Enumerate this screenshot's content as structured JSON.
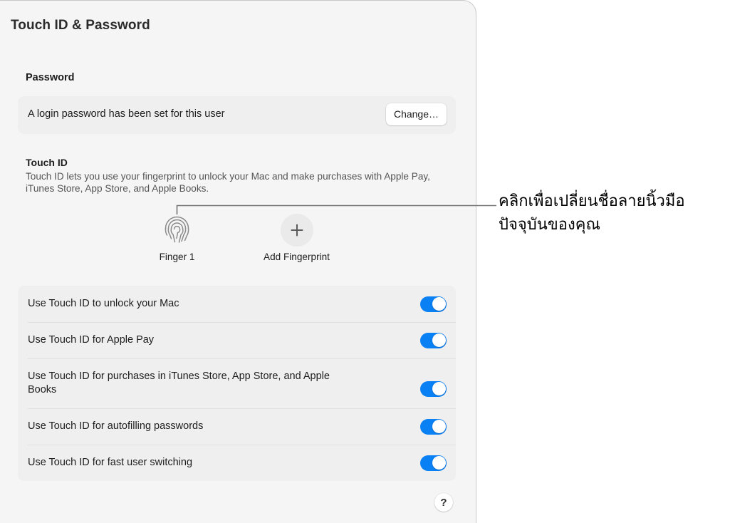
{
  "window": {
    "title": "Touch ID & Password"
  },
  "password_section": {
    "heading": "Password",
    "status_text": "A login password has been set for this user",
    "change_button_label": "Change…"
  },
  "touchid_section": {
    "heading": "Touch ID",
    "description": "Touch ID lets you use your fingerprint to unlock your Mac and make purchases with Apple Pay, iTunes Store, App Store, and Apple Books.",
    "fingerprints": [
      {
        "label": "Finger 1",
        "icon": "fingerprint-icon"
      }
    ],
    "add_fingerprint": {
      "label": "Add Fingerprint",
      "icon": "plus-icon"
    }
  },
  "options": [
    {
      "label": "Use Touch ID to unlock your Mac",
      "enabled": true
    },
    {
      "label": "Use Touch ID for Apple Pay",
      "enabled": true
    },
    {
      "label": "Use Touch ID for purchases in iTunes Store, App Store, and Apple Books",
      "enabled": true
    },
    {
      "label": "Use Touch ID for autofilling passwords",
      "enabled": true
    },
    {
      "label": "Use Touch ID for fast user switching",
      "enabled": true
    }
  ],
  "help_button": {
    "label": "?",
    "icon": "question-mark-icon"
  },
  "annotation": {
    "text": "คลิกเพื่อเปลี่ยนชื่อลายนิ้วมือปัจจุบันของคุณ",
    "line_color": "#757575"
  },
  "colors": {
    "accent_blue": "#0a80f5",
    "window_bg": "#f5f5f5",
    "card_bg": "#efefef",
    "page_bg": "#ffffff",
    "divider": "#e0e0e0",
    "text_primary": "#1d1d1d",
    "text_secondary": "#555555"
  }
}
